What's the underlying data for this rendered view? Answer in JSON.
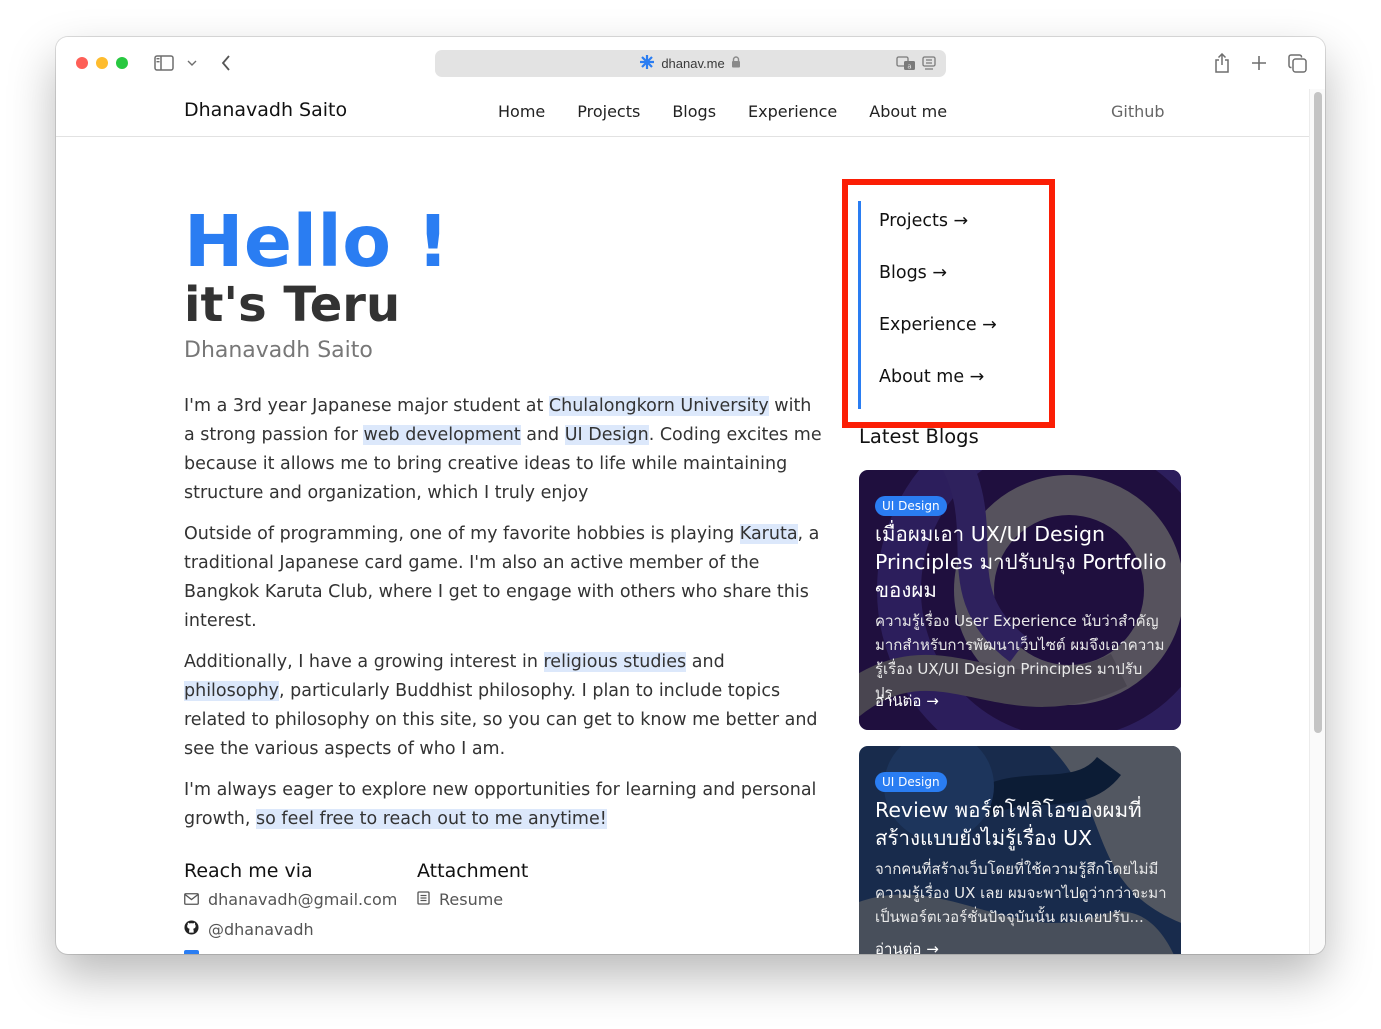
{
  "browser": {
    "url": "dhanav.me"
  },
  "header": {
    "brand": "Dhanavadh Saito",
    "nav": [
      "Home",
      "Projects",
      "Blogs",
      "Experience",
      "About me"
    ],
    "github": "Github"
  },
  "hero": {
    "greeting": "Hello !",
    "intro": "it's Teru",
    "fullname": "Dhanavadh Saito"
  },
  "bio": {
    "p1": {
      "t1": "I'm a 3rd year Japanese major student at ",
      "h1": "Chulalongkorn University",
      "t2": " with a strong passion for ",
      "h2": "web development",
      "t3": " and ",
      "h3": "UI Design",
      "t4": ". Coding excites me because it allows me to bring creative ideas to life while maintaining structure and organization, which I truly enjoy"
    },
    "p2": {
      "t1": "Outside of programming, one of my favorite hobbies is playing ",
      "h1": "Karuta",
      "t2": ", a traditional Japanese card game. I'm also an active member of the Bangkok Karuta Club, where I get to engage with others who share this interest."
    },
    "p3": {
      "t1": "Additionally, I have a growing interest in ",
      "h1": "religious studies",
      "t2": " and ",
      "h2": "philosophy",
      "t3": ", particularly Buddhist philosophy. I plan to include topics related to philosophy on this site, so you can get to know me better and see the various aspects of who I am."
    },
    "p4": {
      "t1": "I'm always eager to explore new opportunities for learning and personal growth, ",
      "h1": "so feel free to reach out to me anytime!"
    }
  },
  "reach": {
    "title": "Reach me via",
    "email": "dhanavadh@gmail.com",
    "github": "@dhanavadh"
  },
  "attachment": {
    "title": "Attachment",
    "resume": "Resume"
  },
  "sidebar": {
    "links": [
      "Projects →",
      "Blogs →",
      "Experience →",
      "About me →"
    ],
    "latest_title": "Latest Blogs"
  },
  "blogs": [
    {
      "tag": "UI Design",
      "title": "เมื่อผมเอา UX/UI Design Principles มาปรับปรุง Portfolio ของผม",
      "desc": "ความรู้เรื่อง User Experience นับว่าสำคัญมากสำหรับการพัฒนาเว็บไซต์ ผมจึงเอาความรู้เรื่อง UX/UI Design Principles มาปรับปรุ...",
      "more": "อ่านต่อ →"
    },
    {
      "tag": "UI Design",
      "title": "Review พอร์ตโฟลิโอของผมที่สร้างแบบยังไม่รู้เรื่อง UX",
      "desc": "จากคนที่สร้างเว็บโดยที่ใช้ความรู้สึกโดยไม่มีความรู้เรื่อง UX เลย ผมจะพาไปดูว่ากว่าจะมาเป็นพอร์ตเวอร์ชั่นปัจจุบันนั้น ผมเคยปรับ...",
      "more": "อ่านต่อ →"
    }
  ],
  "colors": {
    "accent": "#2a7df2",
    "annotation": "#fb1e05",
    "highlight": "#dce8fb"
  }
}
